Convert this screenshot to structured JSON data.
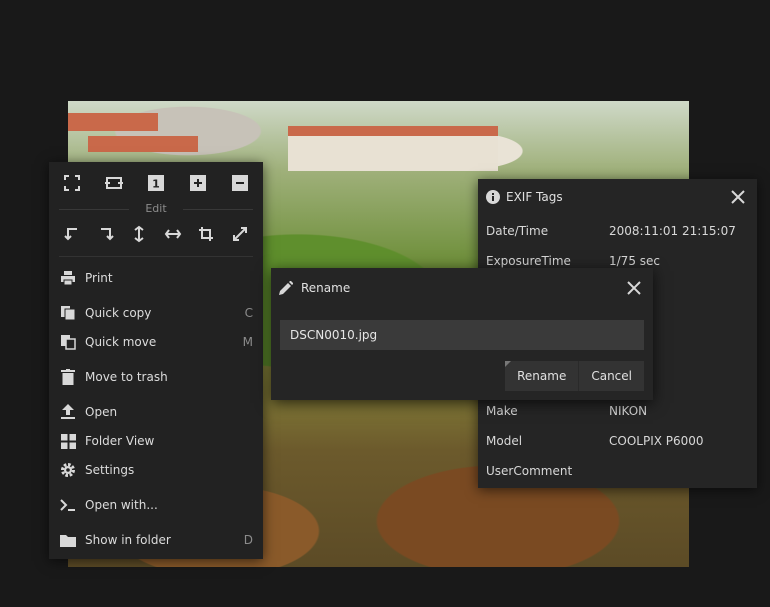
{
  "menu": {
    "edit_label": "Edit",
    "top_icons": [
      "fullscreen-icon",
      "fit-width-icon",
      "actual-size-icon",
      "zoom-in-icon",
      "zoom-out-icon"
    ],
    "actual_size_glyph": "1",
    "edit_icons": [
      "rotate-left-icon",
      "rotate-right-icon",
      "flip-vertical-icon",
      "flip-horizontal-icon",
      "crop-icon",
      "resize-icon"
    ],
    "items": [
      {
        "label": "Print",
        "shortcut": "",
        "icon": "print-icon"
      },
      {
        "label": "Quick copy",
        "shortcut": "C",
        "icon": "copy-icon"
      },
      {
        "label": "Quick move",
        "shortcut": "M",
        "icon": "move-icon"
      },
      {
        "label": "Move to trash",
        "shortcut": "",
        "icon": "trash-icon"
      },
      {
        "label": "Open",
        "shortcut": "",
        "icon": "upload-icon"
      },
      {
        "label": "Folder View",
        "shortcut": "",
        "icon": "grid-icon"
      },
      {
        "label": "Settings",
        "shortcut": "",
        "icon": "gear-icon"
      },
      {
        "label": "Open with...",
        "shortcut": "",
        "icon": "terminal-icon"
      },
      {
        "label": "Show in folder",
        "shortcut": "D",
        "icon": "folder-icon"
      }
    ]
  },
  "exif": {
    "title": "EXIF Tags",
    "rows": [
      {
        "key": "Date/Time",
        "value": "2008:11:01 21:15:07"
      },
      {
        "key": "ExposureTime",
        "value": "1/75 sec"
      },
      {
        "key": "Make",
        "value": "NIKON"
      },
      {
        "key": "Model",
        "value": "COOLPIX P6000"
      },
      {
        "key": "UserComment",
        "value": ""
      }
    ]
  },
  "rename": {
    "title": "Rename",
    "filename": "DSCN0010.jpg",
    "confirm_label": "Rename",
    "cancel_label": "Cancel"
  }
}
